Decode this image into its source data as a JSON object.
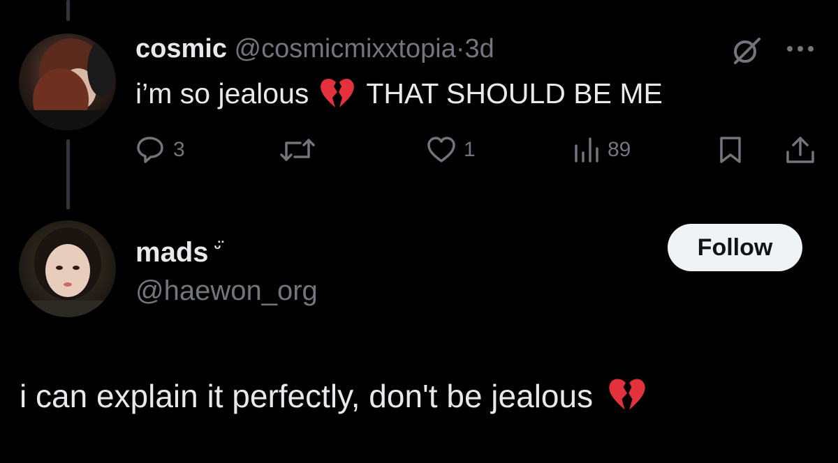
{
  "parent_tweet": {
    "author_name": "cosmic",
    "handle": "@cosmicmixxtopia",
    "dot": "·",
    "time": "3d",
    "text_before_emoji": "i’m so jealous",
    "emoji": "broken-heart-emoji",
    "text_after_emoji": "THAT SHOULD BE ME",
    "actions": {
      "replies": "3",
      "retweets": "",
      "likes": "1",
      "views": "89"
    },
    "icons": [
      "grok-icon",
      "more-icon",
      "reply-icon",
      "retweet-icon",
      "like-icon",
      "views-icon",
      "bookmark-icon",
      "share-icon"
    ]
  },
  "reply_tweet": {
    "author_name": "mads",
    "name_emoticon": "ᵕ̈",
    "handle": "@haewon_org",
    "follow_label": "Follow",
    "text": "i can explain it perfectly, don't be jealous",
    "emoji": "broken-heart-emoji"
  },
  "colors": {
    "background": "#000000",
    "primary_text": "#e7e9ea",
    "secondary_text": "#71767b",
    "thread_line": "#333639",
    "follow_button_bg": "#eff3f4",
    "follow_button_text": "#0f1419",
    "heart_red": "#e3323b"
  }
}
